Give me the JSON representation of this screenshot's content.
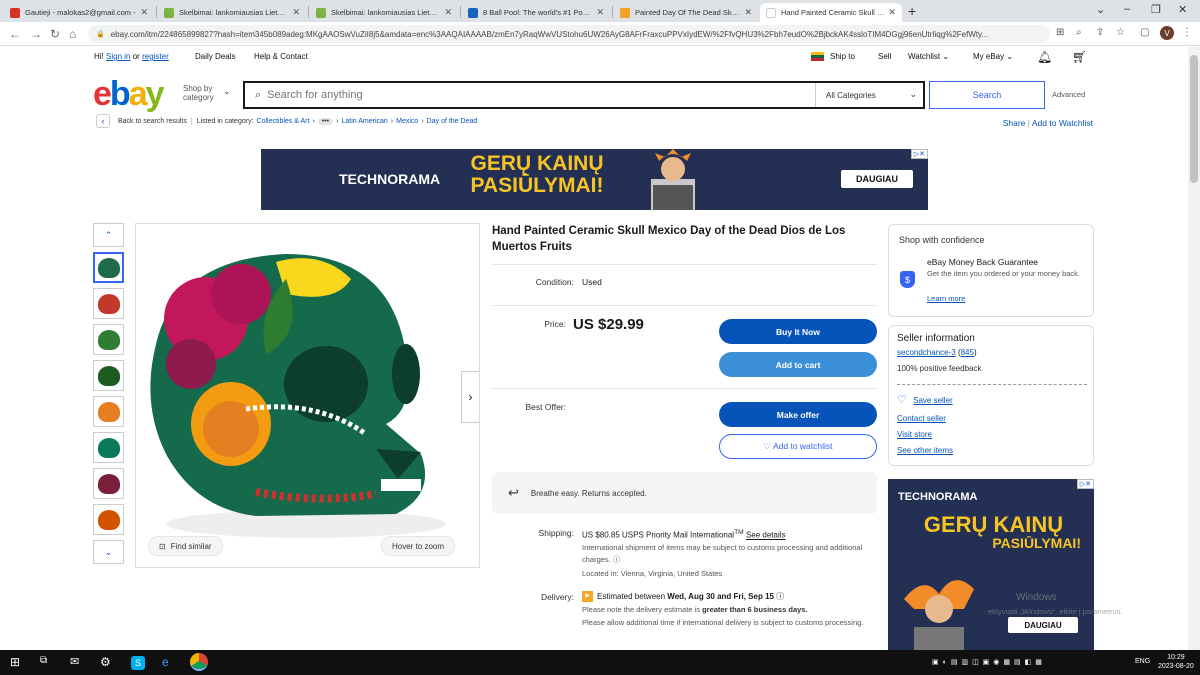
{
  "browser": {
    "tabs": [
      {
        "title": "Gautieji - malokas2@gmail.com -",
        "favicon_color": "#d93025"
      },
      {
        "title": "Skelbimai: lankomiausias Lietuvo",
        "favicon_color": "#7cb342"
      },
      {
        "title": "Skelbimai: lankomiausias Lietuvo",
        "favicon_color": "#7cb342"
      },
      {
        "title": "8 Ball Pool: The world's #1 Pool g",
        "favicon_color": "#1565c0"
      },
      {
        "title": "Painted Day Of The Dead Skulls f",
        "favicon_color": "#f4a020"
      },
      {
        "title": "Hand Painted Ceramic Skull Mex",
        "favicon_color": "#ffffff"
      }
    ],
    "url": "ebay.com/itm/224865899827?hash=item345b089adeg:MKgAAOSwVuZiI8j5&amdata=enc%3AAQAIAAAAB/zmEn7yRaqWwVUStohu6UW26AyG8AFrFraxcuPPVxIydEW/%2FfvQHU3%2Fbh7eudO%2BjbckAK4ssloTIM4DGgj96enUtrIiqg%2FefWty..."
  },
  "header": {
    "greeting_prefix": "Hi!",
    "sign_in": "Sign in",
    "or": "or",
    "register": "register",
    "daily_deals": "Daily Deals",
    "help": "Help & Contact",
    "ship_to": "Ship to",
    "sell": "Sell",
    "watchlist": "Watchlist",
    "my_ebay": "My eBay"
  },
  "search": {
    "shop_by_line1": "Shop by",
    "shop_by_line2": "category",
    "placeholder": "Search for anything",
    "category": "All Categories",
    "button": "Search",
    "advanced": "Advanced"
  },
  "breadcrumb": {
    "back": "Back to search results",
    "listed_in": "Listed in category:",
    "items": [
      "Collectibles & Art",
      "Latin American",
      "Mexico",
      "Day of the Dead"
    ],
    "share": "Share",
    "add_watchlist": "Add to Watchlist"
  },
  "ad_banner": {
    "brand": "TECHNORAMA",
    "line1": "GERŲ KAINŲ",
    "line2": "PASIŪLYMAI!",
    "cta": "DAUGIAU"
  },
  "gallery": {
    "find_similar": "Find similar",
    "hover_zoom": "Hover to zoom",
    "thumb_colors": [
      "#1f6b4a",
      "#c0392b",
      "#2e7d32",
      "#1b5e20",
      "#e67e22",
      "#0b7a5a",
      "#7b1e3a",
      "#d35400"
    ]
  },
  "item": {
    "title": "Hand Painted Ceramic Skull Mexico Day of the Dead Dios de Los Muertos Fruits",
    "condition_label": "Condition:",
    "condition_value": "Used",
    "price_label": "Price:",
    "price": "US $29.99",
    "buy_now": "Buy It Now",
    "add_cart": "Add to cart",
    "best_offer_label": "Best Offer:",
    "make_offer": "Make offer",
    "add_watchlist": "♡ Add to watchlist",
    "returns": "Breathe easy. Returns accepted.",
    "shipping_label": "Shipping:",
    "shipping_cost": "US $80.85 USPS Priority Mail International",
    "shipping_tm": "TM",
    "see_details": "See details",
    "shipping_note": "International shipment of items may be subject to customs processing and additional charges.",
    "located": "Located in: Vienna, Virginia, United States",
    "delivery_label": "Delivery:",
    "delivery_est_prefix": "Estimated between",
    "delivery_est_dates": "Wed, Aug 30 and Fri, Sep 15",
    "delivery_note1_prefix": "Please note the delivery estimate is",
    "delivery_note1_bold": "greater than 6 business days.",
    "delivery_note2": "Please allow additional time if international delivery is subject to customs processing."
  },
  "confidence": {
    "heading": "Shop with confidence",
    "guarantee": "eBay Money Back Guarantee",
    "desc": "Get the item you ordered or your money back.",
    "learn_more": "Learn more"
  },
  "seller": {
    "heading": "Seller information",
    "name": "secondchance-3",
    "feedback_count": "845",
    "positive": "100% positive feedback",
    "save_seller": "Save seller",
    "contact": "Contact seller",
    "visit": "Visit store",
    "other": "See other items"
  },
  "windows": {
    "watermark1": "Windows",
    "watermark2": "ektyvuoti „Windows“, eikite į parametrus.",
    "time": "10:29",
    "date": "2023-08-20",
    "lang": "ENG"
  }
}
